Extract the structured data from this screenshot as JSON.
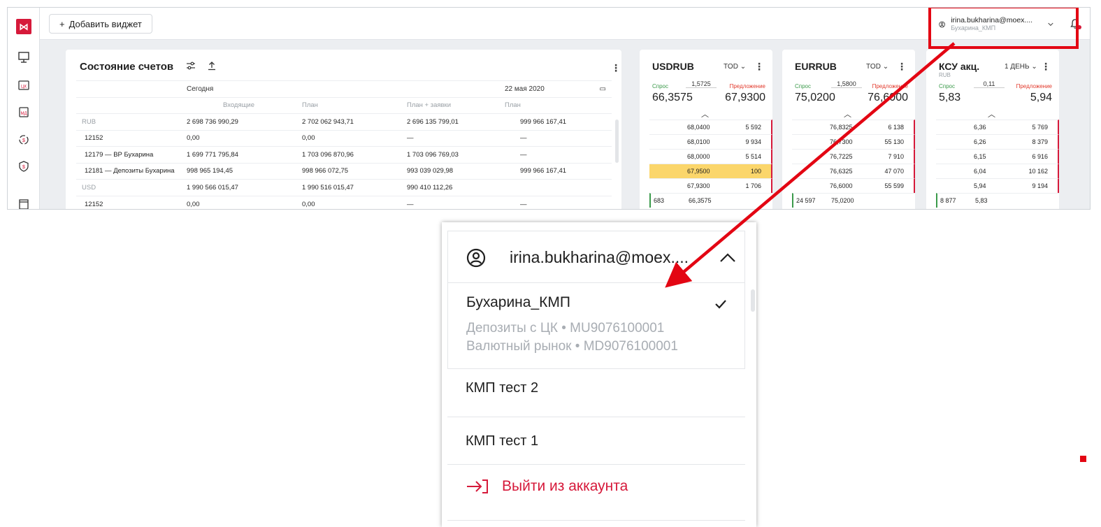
{
  "topbar": {
    "add_widget_label": "Добавить виджет",
    "user_email": "irina.bukharina@moex....",
    "user_sub": "Бухарина_КМП"
  },
  "accounts": {
    "title": "Состояние счетов",
    "col_today": "Сегодня",
    "col_date": "22 мая 2020",
    "sub_incoming": "Входящие",
    "sub_plan": "План",
    "sub_plan_orders": "План + заявки",
    "sub_plan2": "План",
    "rows": [
      {
        "name": "RUB",
        "c1": "2 698 736 990,29",
        "c2": "2 702 062 943,71",
        "c3": "2 696 135 799,01",
        "c4": "999 966 167,41",
        "currency": true
      },
      {
        "name": "12152",
        "c1": "0,00",
        "c2": "0,00",
        "c3": "—",
        "c4": "—",
        "currency": false
      },
      {
        "name": "12179 — ВР Бухарина",
        "c1": "1 699 771 795,84",
        "c2": "1 703 096 870,96",
        "c3": "1 703 096 769,03",
        "c4": "—",
        "currency": false
      },
      {
        "name": "12181 — Депозиты Бухарина",
        "c1": "998 965 194,45",
        "c2": "998 966 072,75",
        "c3": "993 039 029,98",
        "c4": "999 966 167,41",
        "currency": false
      },
      {
        "name": "USD",
        "c1": "1 990 566 015,47",
        "c2": "1 990 516 015,47",
        "c3": "990 410 112,26",
        "c4": "",
        "currency": true
      },
      {
        "name": "12152",
        "c1": "0,00",
        "c2": "0,00",
        "c3": "—",
        "c4": "—",
        "currency": false
      }
    ]
  },
  "fx": {
    "usd": {
      "title": "USDRUB",
      "tod": "TOD",
      "bid_label": "Спрос",
      "ask_label": "Предложение",
      "spread": "1,5725",
      "bid": "66,3575",
      "ask": "67,9300",
      "rows": [
        {
          "px": "68,0400",
          "ask": "5 592",
          "bid": "",
          "side": "ask",
          "hl": false
        },
        {
          "px": "68,0100",
          "ask": "9 934",
          "bid": "",
          "side": "ask",
          "hl": false
        },
        {
          "px": "68,0000",
          "ask": "5 514",
          "bid": "",
          "side": "ask",
          "hl": false
        },
        {
          "px": "67,9500",
          "ask": "100",
          "bid": "",
          "side": "ask",
          "hl": true
        },
        {
          "px": "67,9300",
          "ask": "1 706",
          "bid": "",
          "side": "ask",
          "hl": false
        },
        {
          "px": "66,3575",
          "ask": "",
          "bid": "683",
          "side": "bid",
          "hl": false
        }
      ]
    },
    "eur": {
      "title": "EURRUB",
      "tod": "TOD",
      "bid_label": "Спрос",
      "ask_label": "Предложение",
      "spread": "1,5800",
      "bid": "75,0200",
      "ask": "76,6000",
      "rows": [
        {
          "px": "76,8325",
          "ask": "6 138",
          "bid": "",
          "side": "ask",
          "hl": false
        },
        {
          "px": "76,7300",
          "ask": "55 130",
          "bid": "",
          "side": "ask",
          "hl": false
        },
        {
          "px": "76,7225",
          "ask": "7 910",
          "bid": "",
          "side": "ask",
          "hl": false
        },
        {
          "px": "76,6325",
          "ask": "47 070",
          "bid": "",
          "side": "ask",
          "hl": false
        },
        {
          "px": "76,6000",
          "ask": "55 599",
          "bid": "",
          "side": "ask",
          "hl": false
        },
        {
          "px": "75,0200",
          "ask": "",
          "bid": "24 597",
          "side": "bid",
          "hl": false
        }
      ]
    },
    "ksu": {
      "title": "КСУ акц.",
      "tod": "1 ДЕНЬ",
      "currency": "RUB",
      "bid_label": "Спрос",
      "ask_label": "Предложение",
      "spread": "0,11",
      "bid": "5,83",
      "ask": "5,94",
      "rows": [
        {
          "px": "6,36",
          "ask": "5 769",
          "bid": "",
          "side": "ask",
          "hl": false
        },
        {
          "px": "6,26",
          "ask": "8 379",
          "bid": "",
          "side": "ask",
          "hl": false
        },
        {
          "px": "6,15",
          "ask": "6 916",
          "bid": "",
          "side": "ask",
          "hl": false
        },
        {
          "px": "6,04",
          "ask": "10 162",
          "bid": "",
          "side": "ask",
          "hl": false
        },
        {
          "px": "5,94",
          "ask": "9 194",
          "bid": "",
          "side": "ask",
          "hl": false
        },
        {
          "px": "5,83",
          "ask": "",
          "bid": "8 877",
          "side": "bid",
          "hl": false
        }
      ]
    }
  },
  "dropdown": {
    "email": "irina.bukharina@moex....",
    "active_account": "Бухарина_КМП",
    "active_sub1": "Депозиты с ЦК • MU9076100001",
    "active_sub2": "Валютный рынок • MD9076100001",
    "item1": "КМП тест 2",
    "item2": "КМП тест 1",
    "logout": "Выйти из аккаунта"
  },
  "colors": {
    "accent": "#d6193a",
    "annotation": "#e30613",
    "bid": "#3a9a4a",
    "highlight": "#fbd66b"
  }
}
